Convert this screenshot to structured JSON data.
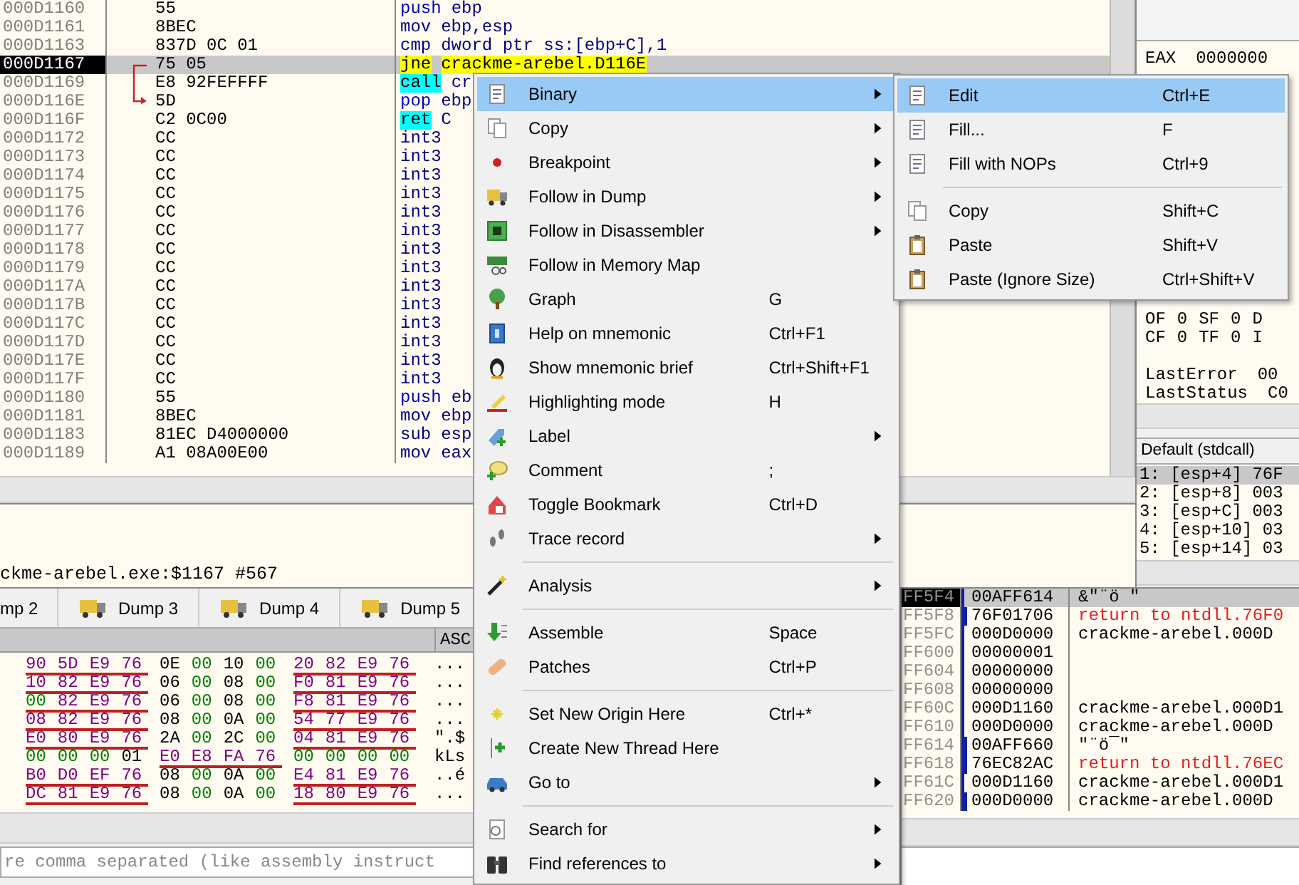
{
  "disassembly": {
    "rows": [
      {
        "address": "000D1160",
        "bytes": "55",
        "mnemonic": "push",
        "operands": "ebp",
        "kind": "stack",
        "selected": false
      },
      {
        "address": "000D1161",
        "bytes": "8BEC",
        "mnemonic": "mov",
        "operands": "ebp,esp",
        "kind": "plain",
        "selected": false
      },
      {
        "address": "000D1163",
        "bytes": "837D 0C 01",
        "mnemonic": "cmp",
        "operands": "dword ptr ss:[ebp+C],1",
        "kind": "plain",
        "selected": false
      },
      {
        "address": "000D1167",
        "bytes": "75 05",
        "mnemonic": "jne",
        "operands": "crackme-arebel.D116E",
        "kind": "jump",
        "selected": true,
        "jump_from": true
      },
      {
        "address": "000D1169",
        "bytes": "E8 92FEFFFF",
        "mnemonic": "call",
        "operands": "cr",
        "kind": "call",
        "selected": false
      },
      {
        "address": "000D116E",
        "bytes": "5D",
        "mnemonic": "pop",
        "operands": "ebp",
        "kind": "stack",
        "selected": false,
        "jump_to": true
      },
      {
        "address": "000D116F",
        "bytes": "C2 0C00",
        "mnemonic": "ret",
        "operands": "C",
        "kind": "ret",
        "selected": false
      },
      {
        "address": "000D1172",
        "bytes": "CC",
        "mnemonic": "int3",
        "kind": "plain",
        "selected": false
      },
      {
        "address": "000D1173",
        "bytes": "CC",
        "mnemonic": "int3",
        "kind": "plain",
        "selected": false
      },
      {
        "address": "000D1174",
        "bytes": "CC",
        "mnemonic": "int3",
        "kind": "plain",
        "selected": false
      },
      {
        "address": "000D1175",
        "bytes": "CC",
        "mnemonic": "int3",
        "kind": "plain",
        "selected": false
      },
      {
        "address": "000D1176",
        "bytes": "CC",
        "mnemonic": "int3",
        "kind": "plain",
        "selected": false
      },
      {
        "address": "000D1177",
        "bytes": "CC",
        "mnemonic": "int3",
        "kind": "plain",
        "selected": false
      },
      {
        "address": "000D1178",
        "bytes": "CC",
        "mnemonic": "int3",
        "kind": "plain",
        "selected": false
      },
      {
        "address": "000D1179",
        "bytes": "CC",
        "mnemonic": "int3",
        "kind": "plain",
        "selected": false
      },
      {
        "address": "000D117A",
        "bytes": "CC",
        "mnemonic": "int3",
        "kind": "plain",
        "selected": false
      },
      {
        "address": "000D117B",
        "bytes": "CC",
        "mnemonic": "int3",
        "kind": "plain",
        "selected": false
      },
      {
        "address": "000D117C",
        "bytes": "CC",
        "mnemonic": "int3",
        "kind": "plain",
        "selected": false
      },
      {
        "address": "000D117D",
        "bytes": "CC",
        "mnemonic": "int3",
        "kind": "plain",
        "selected": false
      },
      {
        "address": "000D117E",
        "bytes": "CC",
        "mnemonic": "int3",
        "kind": "plain",
        "selected": false
      },
      {
        "address": "000D117F",
        "bytes": "CC",
        "mnemonic": "int3",
        "kind": "plain",
        "selected": false
      },
      {
        "address": "000D1180",
        "bytes": "55",
        "mnemonic": "push",
        "operands": "eb",
        "kind": "stack",
        "selected": false
      },
      {
        "address": "000D1181",
        "bytes": "8BEC",
        "mnemonic": "mov",
        "operands": "ebp",
        "kind": "plain",
        "selected": false
      },
      {
        "address": "000D1183",
        "bytes": "81EC D4000000",
        "mnemonic": "sub",
        "operands": "esp",
        "kind": "plain",
        "selected": false
      },
      {
        "address": "000D1189",
        "bytes": "A1 08A00E00",
        "mnemonic": "mov",
        "operands": "eax",
        "kind": "plain",
        "selected": false
      }
    ]
  },
  "info_panel": {
    "text": "ckme-arebel.exe:$1167 #567"
  },
  "registers": {
    "eax": {
      "name": "EAX",
      "value": "0000000"
    },
    "flag_rows": [
      {
        "cells": [
          "OF",
          "0",
          "SF",
          "0",
          "D"
        ]
      },
      {
        "cells": [
          "CF",
          "0",
          "TF",
          "0",
          "I"
        ]
      }
    ],
    "status_rows": [
      {
        "name": "LastError",
        "value": "00"
      },
      {
        "name": "LastStatus",
        "value": "C0"
      }
    ]
  },
  "call_args": {
    "title": "Default (stdcall)",
    "rows": [
      {
        "text": "1: [esp+4] 76F",
        "selected": true
      },
      {
        "text": "2: [esp+8] 003",
        "selected": false
      },
      {
        "text": "3: [esp+C] 003",
        "selected": false
      },
      {
        "text": "4: [esp+10] 03",
        "selected": false
      },
      {
        "text": "5: [esp+14] 03",
        "selected": false
      }
    ]
  },
  "dump_tabs": [
    {
      "label": "mp 2"
    },
    {
      "label": "Dump 3"
    },
    {
      "label": "Dump 4"
    },
    {
      "label": "Dump 5"
    }
  ],
  "dump": {
    "ascii_header": "ASC",
    "rows": [
      {
        "groups": [
          {
            "bytes": [
              "90",
              "5D",
              "E9",
              "76"
            ],
            "pointer": true
          },
          {
            "bytes": [
              "0E",
              "00",
              "10",
              "00"
            ],
            "pointer": false
          },
          {
            "bytes": [
              "20",
              "82",
              "E9",
              "76"
            ],
            "pointer": true
          }
        ],
        "ascii": "..."
      },
      {
        "groups": [
          {
            "bytes": [
              "10",
              "82",
              "E9",
              "76"
            ],
            "pointer": true
          },
          {
            "bytes": [
              "06",
              "00",
              "08",
              "00"
            ],
            "pointer": false
          },
          {
            "bytes": [
              "F0",
              "81",
              "E9",
              "76"
            ],
            "pointer": true
          }
        ],
        "ascii": "..."
      },
      {
        "groups": [
          {
            "bytes": [
              "00",
              "82",
              "E9",
              "76"
            ],
            "pointer": true
          },
          {
            "bytes": [
              "06",
              "00",
              "08",
              "00"
            ],
            "pointer": false
          },
          {
            "bytes": [
              "F8",
              "81",
              "E9",
              "76"
            ],
            "pointer": true
          }
        ],
        "ascii": "..."
      },
      {
        "groups": [
          {
            "bytes": [
              "08",
              "82",
              "E9",
              "76"
            ],
            "pointer": true
          },
          {
            "bytes": [
              "08",
              "00",
              "0A",
              "00"
            ],
            "pointer": false
          },
          {
            "bytes": [
              "54",
              "77",
              "E9",
              "76"
            ],
            "pointer": true
          }
        ],
        "ascii": "..."
      },
      {
        "groups": [
          {
            "bytes": [
              "E0",
              "80",
              "E9",
              "76"
            ],
            "pointer": true
          },
          {
            "bytes": [
              "2A",
              "00",
              "2C",
              "00"
            ],
            "pointer": false
          },
          {
            "bytes": [
              "04",
              "81",
              "E9",
              "76"
            ],
            "pointer": true
          }
        ],
        "ascii": "\".$"
      },
      {
        "groups": [
          {
            "bytes": [
              "00",
              "00",
              "00",
              "01"
            ],
            "pointer": false
          },
          {
            "bytes": [
              "E0",
              "E8",
              "FA",
              "76"
            ],
            "pointer": true
          },
          {
            "bytes": [
              "00",
              "00",
              "00",
              "00"
            ],
            "pointer": false
          }
        ],
        "ascii": "kLs"
      },
      {
        "groups": [
          {
            "bytes": [
              "B0",
              "D0",
              "EF",
              "76"
            ],
            "pointer": true
          },
          {
            "bytes": [
              "08",
              "00",
              "0A",
              "00"
            ],
            "pointer": false
          },
          {
            "bytes": [
              "E4",
              "81",
              "E9",
              "76"
            ],
            "pointer": true
          }
        ],
        "ascii": "..é"
      },
      {
        "groups": [
          {
            "bytes": [
              "DC",
              "81",
              "E9",
              "76"
            ],
            "pointer": true
          },
          {
            "bytes": [
              "08",
              "00",
              "0A",
              "00"
            ],
            "pointer": false
          },
          {
            "bytes": [
              "18",
              "80",
              "E9",
              "76"
            ],
            "pointer": true
          }
        ],
        "ascii": "..."
      }
    ]
  },
  "command": {
    "placeholder": "re comma separated (like assembly instruct"
  },
  "stack": {
    "rows": [
      {
        "address": "FF5F4",
        "value": "00AFF614",
        "comment": "&\"¨ö¯\"",
        "kind": "normal",
        "selected": true,
        "in_frame": false,
        "frame_start": false
      },
      {
        "address": "FF5F8",
        "value": "76F01706",
        "comment": "return to ntdll.76F0",
        "kind": "return",
        "selected": false,
        "in_frame": true,
        "frame_start": true
      },
      {
        "address": "FF5FC",
        "value": "000D0000",
        "comment": "crackme-arebel.000D",
        "kind": "normal",
        "selected": false,
        "in_frame": true,
        "frame_start": false
      },
      {
        "address": "FF600",
        "value": "00000001",
        "selected": false,
        "in_frame": true,
        "frame_start": false
      },
      {
        "address": "FF604",
        "value": "00000000",
        "selected": false,
        "in_frame": true,
        "frame_start": false
      },
      {
        "address": "FF608",
        "value": "00000000",
        "selected": false,
        "in_frame": true,
        "frame_start": false
      },
      {
        "address": "FF60C",
        "value": "000D1160",
        "comment": "crackme-arebel.000D1",
        "kind": "normal",
        "selected": false,
        "in_frame": true,
        "frame_start": false
      },
      {
        "address": "FF610",
        "value": "000D0000",
        "comment": "crackme-arebel.000D",
        "kind": "normal",
        "selected": false,
        "in_frame": true,
        "frame_start": false
      },
      {
        "address": "FF614",
        "value": "00AFF660",
        "comment": "\"¨ö¯\"",
        "kind": "normal",
        "selected": false,
        "in_frame": true,
        "frame_start": false
      },
      {
        "address": "FF618",
        "value": "76EC82AC",
        "comment": "return to ntdll.76EC",
        "kind": "return",
        "selected": false,
        "in_frame": true,
        "frame_start": true
      },
      {
        "address": "FF61C",
        "value": "000D1160",
        "comment": "crackme-arebel.000D1",
        "kind": "normal",
        "selected": false,
        "in_frame": true,
        "frame_start": false
      },
      {
        "address": "FF620",
        "value": "000D0000",
        "comment": "crackme-arebel.000D",
        "kind": "normal",
        "selected": false,
        "in_frame": true,
        "frame_start": false
      }
    ]
  },
  "context_menu": {
    "items": [
      {
        "kind": "item",
        "label": "Binary",
        "submenu": true,
        "selected": true
      },
      {
        "kind": "item",
        "label": "Copy",
        "submenu": true,
        "selected": false
      },
      {
        "kind": "item",
        "label": "Breakpoint",
        "submenu": true,
        "selected": false
      },
      {
        "kind": "item",
        "label": "Follow in Dump",
        "submenu": true,
        "selected": false
      },
      {
        "kind": "item",
        "label": "Follow in Disassembler",
        "submenu": true,
        "selected": false
      },
      {
        "kind": "item",
        "label": "Follow in Memory Map",
        "submenu": false,
        "selected": false
      },
      {
        "kind": "item",
        "label": "Graph",
        "shortcut": "G",
        "submenu": false,
        "selected": false
      },
      {
        "kind": "item",
        "label": "Help on mnemonic",
        "shortcut": "Ctrl+F1",
        "submenu": false,
        "selected": false
      },
      {
        "kind": "item",
        "label": "Show mnemonic brief",
        "shortcut": "Ctrl+Shift+F1",
        "submenu": false,
        "selected": false
      },
      {
        "kind": "item",
        "label": "Highlighting mode",
        "shortcut": "H",
        "submenu": false,
        "selected": false
      },
      {
        "kind": "item",
        "label": "Label",
        "submenu": true,
        "selected": false
      },
      {
        "kind": "item",
        "label": "Comment",
        "shortcut": ";",
        "submenu": false,
        "selected": false
      },
      {
        "kind": "item",
        "label": "Toggle Bookmark",
        "shortcut": "Ctrl+D",
        "submenu": false,
        "selected": false
      },
      {
        "kind": "item",
        "label": "Trace record",
        "submenu": true,
        "selected": false
      },
      {
        "kind": "separator"
      },
      {
        "kind": "item",
        "label": "Analysis",
        "submenu": true,
        "selected": false
      },
      {
        "kind": "separator"
      },
      {
        "kind": "item",
        "label": "Assemble",
        "shortcut": "Space",
        "submenu": false,
        "selected": false
      },
      {
        "kind": "item",
        "label": "Patches",
        "shortcut": "Ctrl+P",
        "submenu": false,
        "selected": false
      },
      {
        "kind": "separator"
      },
      {
        "kind": "item",
        "label": "Set New Origin Here",
        "shortcut": "Ctrl+*",
        "submenu": false,
        "selected": false
      },
      {
        "kind": "item",
        "label": "Create New Thread Here",
        "submenu": false,
        "selected": false
      },
      {
        "kind": "item",
        "label": "Go to",
        "submenu": true,
        "selected": false
      },
      {
        "kind": "separator"
      },
      {
        "kind": "item",
        "label": "Search for",
        "submenu": true,
        "selected": false
      },
      {
        "kind": "item",
        "label": "Find references to",
        "submenu": true,
        "selected": false
      }
    ]
  },
  "submenu": {
    "items": [
      {
        "kind": "item",
        "label": "Edit",
        "shortcut": "Ctrl+E",
        "selected": true
      },
      {
        "kind": "item",
        "label": "Fill...",
        "shortcut": "F",
        "selected": false
      },
      {
        "kind": "item",
        "label": "Fill with NOPs",
        "shortcut": "Ctrl+9",
        "selected": false
      },
      {
        "kind": "separator"
      },
      {
        "kind": "item",
        "label": "Copy",
        "shortcut": "Shift+C",
        "selected": false
      },
      {
        "kind": "item",
        "label": "Paste",
        "shortcut": "Shift+V",
        "selected": false
      },
      {
        "kind": "item",
        "label": "Paste (Ignore Size)",
        "shortcut": "Ctrl+Shift+V",
        "selected": false
      }
    ]
  }
}
